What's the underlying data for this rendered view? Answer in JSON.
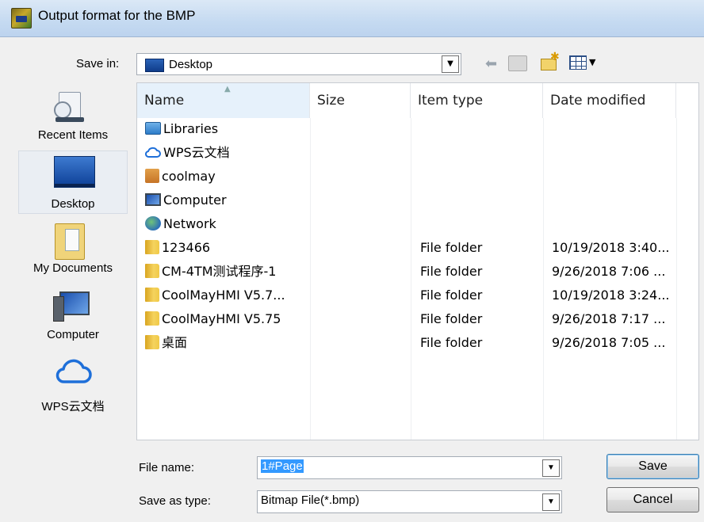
{
  "window": {
    "title": "Output format for the BMP"
  },
  "save_in": {
    "label": "Save in:",
    "value": "Desktop"
  },
  "places": [
    {
      "label": "Recent Items",
      "icon": "recent-items-icon"
    },
    {
      "label": "Desktop",
      "icon": "desktop-icon",
      "selected": true
    },
    {
      "label": "My Documents",
      "icon": "my-documents-icon"
    },
    {
      "label": "Computer",
      "icon": "computer-icon"
    },
    {
      "label": "WPS云文档",
      "icon": "cloud-icon"
    }
  ],
  "columns": {
    "name": "Name",
    "size": "Size",
    "type": "Item type",
    "date": "Date modified"
  },
  "files": [
    {
      "name": "Libraries",
      "icon": "libraries-icon",
      "type": "",
      "date": ""
    },
    {
      "name": "WPS云文档",
      "icon": "cloud-icon",
      "type": "",
      "date": ""
    },
    {
      "name": "coolmay",
      "icon": "user-folder-icon",
      "type": "",
      "date": ""
    },
    {
      "name": "Computer",
      "icon": "computer-icon",
      "type": "",
      "date": ""
    },
    {
      "name": "Network",
      "icon": "network-icon",
      "type": "",
      "date": ""
    },
    {
      "name": "123466",
      "icon": "folder-icon",
      "type": "File folder",
      "date": "10/19/2018 3:40..."
    },
    {
      "name": "CM-4TM测试程序-1",
      "icon": "folder-icon",
      "type": "File folder",
      "date": "9/26/2018 7:06 ..."
    },
    {
      "name": "CoolMayHMI V5.7...",
      "icon": "folder-icon",
      "type": "File folder",
      "date": "10/19/2018 3:24..."
    },
    {
      "name": "CoolMayHMI V5.75",
      "icon": "folder-icon",
      "type": "File folder",
      "date": "9/26/2018 7:17 ..."
    },
    {
      "name": "桌面",
      "icon": "folder-icon",
      "type": "File folder",
      "date": "9/26/2018 7:05 ..."
    }
  ],
  "file_name": {
    "label": "File name:",
    "value": "1#Page"
  },
  "save_as_type": {
    "label": "Save as type:",
    "value": "Bitmap File(*.bmp)"
  },
  "buttons": {
    "save": "Save",
    "cancel": "Cancel"
  }
}
